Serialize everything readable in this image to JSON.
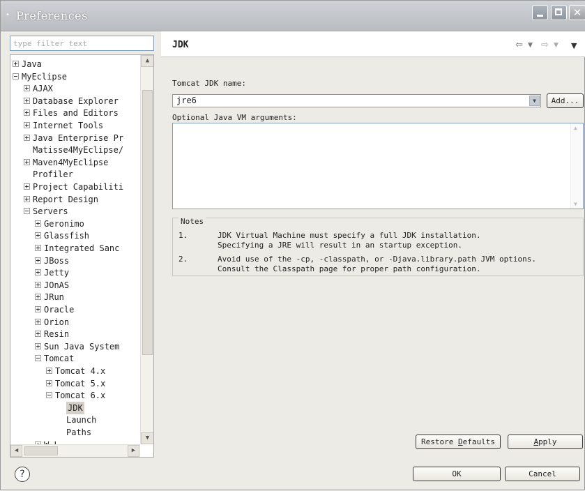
{
  "window": {
    "title": "Preferences"
  },
  "filter": {
    "placeholder": "type filter text"
  },
  "tree": [
    {
      "label": "Java",
      "level": 0,
      "toggle": "plus"
    },
    {
      "label": "MyEclipse",
      "level": 0,
      "toggle": "minus"
    },
    {
      "label": "AJAX",
      "level": 1,
      "toggle": "plus"
    },
    {
      "label": "Database Explorer",
      "level": 1,
      "toggle": "plus"
    },
    {
      "label": "Files and Editors",
      "level": 1,
      "toggle": "plus"
    },
    {
      "label": "Internet Tools",
      "level": 1,
      "toggle": "plus"
    },
    {
      "label": "Java Enterprise Pr",
      "level": 1,
      "toggle": "plus"
    },
    {
      "label": "Matisse4MyEclipse/",
      "level": 1,
      "toggle": "none"
    },
    {
      "label": "Maven4MyEclipse",
      "level": 1,
      "toggle": "plus"
    },
    {
      "label": "Profiler",
      "level": 1,
      "toggle": "none"
    },
    {
      "label": "Project Capabiliti",
      "level": 1,
      "toggle": "plus"
    },
    {
      "label": "Report Design",
      "level": 1,
      "toggle": "plus"
    },
    {
      "label": "Servers",
      "level": 1,
      "toggle": "minus"
    },
    {
      "label": "Geronimo",
      "level": 2,
      "toggle": "plus"
    },
    {
      "label": "Glassfish",
      "level": 2,
      "toggle": "plus"
    },
    {
      "label": "Integrated Sanc",
      "level": 2,
      "toggle": "plus"
    },
    {
      "label": "JBoss",
      "level": 2,
      "toggle": "plus"
    },
    {
      "label": "Jetty",
      "level": 2,
      "toggle": "plus"
    },
    {
      "label": "JOnAS",
      "level": 2,
      "toggle": "plus"
    },
    {
      "label": "JRun",
      "level": 2,
      "toggle": "plus"
    },
    {
      "label": "Oracle",
      "level": 2,
      "toggle": "plus"
    },
    {
      "label": "Orion",
      "level": 2,
      "toggle": "plus"
    },
    {
      "label": "Resin",
      "level": 2,
      "toggle": "plus"
    },
    {
      "label": "Sun Java System",
      "level": 2,
      "toggle": "plus"
    },
    {
      "label": "Tomcat",
      "level": 2,
      "toggle": "minus"
    },
    {
      "label": "Tomcat  4.x",
      "level": 3,
      "toggle": "plus"
    },
    {
      "label": "Tomcat  5.x",
      "level": 3,
      "toggle": "plus"
    },
    {
      "label": "Tomcat  6.x",
      "level": 3,
      "toggle": "minus"
    },
    {
      "label": "JDK",
      "level": 4,
      "toggle": "none",
      "selected": true
    },
    {
      "label": "Launch",
      "level": 4,
      "toggle": "none"
    },
    {
      "label": "Paths",
      "level": 4,
      "toggle": "none"
    },
    {
      "label": "W.L.",
      "level": 2,
      "toggle": "plus"
    }
  ],
  "page": {
    "title": "JDK",
    "jdk_name_label": "Tomcat JDK name:",
    "jdk_name_value": "jre6",
    "add_button": "Add...",
    "vm_args_label": "Optional Java VM arguments:",
    "vm_args_value": "",
    "notes_title": "Notes",
    "notes": [
      {
        "num": "1.",
        "line1": "JDK Virtual Machine must specify a full JDK installation.",
        "line2": "Specifying a JRE will result in an startup exception."
      },
      {
        "num": "2.",
        "line1": "Avoid use of the -cp, -classpath, or -Djava.library.path JVM options.",
        "line2": "Consult the Classpath page for proper path configuration."
      }
    ],
    "restore_defaults": {
      "before": "Restore ",
      "mnemonic": "D",
      "after": "efaults"
    },
    "apply": {
      "before": "",
      "mnemonic": "A",
      "after": "pply"
    }
  },
  "footer": {
    "help": "?",
    "ok": "OK",
    "cancel": "Cancel"
  }
}
